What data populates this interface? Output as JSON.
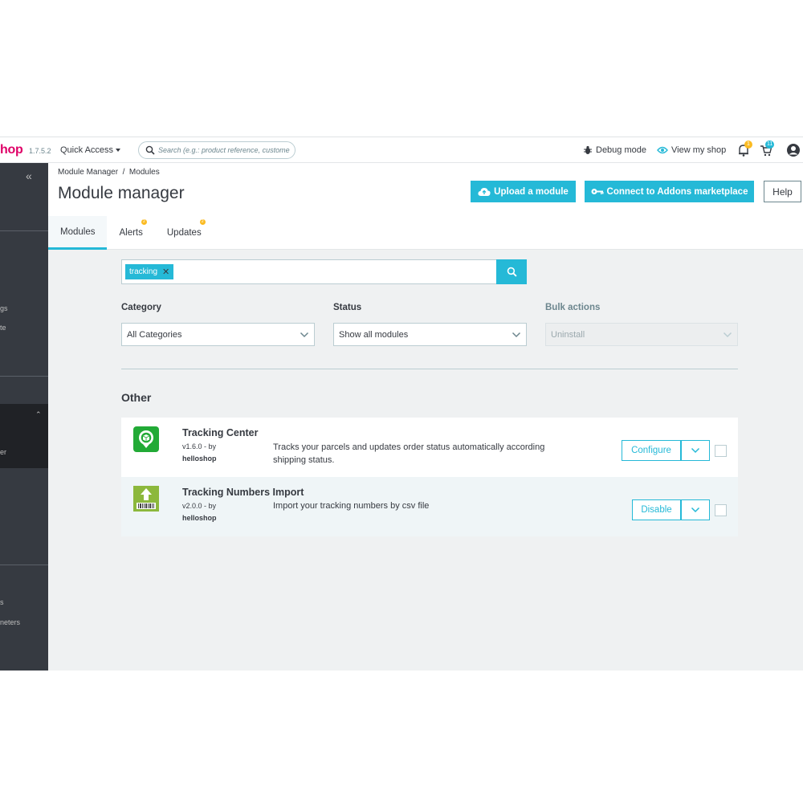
{
  "header": {
    "logo_text": "hop",
    "version": "1.7.5.2",
    "quick_access": "Quick Access",
    "search_placeholder": "Search (e.g.: product reference, custome",
    "debug_mode": "Debug mode",
    "view_shop": "View my shop",
    "notifications_count": "1",
    "orders_count": "11"
  },
  "sidebar": {
    "collapse_glyph": "«",
    "fragments": [
      "gs",
      "te",
      "er",
      "s",
      "neters"
    ]
  },
  "page": {
    "breadcrumb": "Module Manager  /  Modules",
    "title": "Module manager",
    "upload_button": "Upload a module",
    "addons_button": "Connect to Addons marketplace",
    "help_button": "Help",
    "tabs": [
      {
        "label": "Modules",
        "badge": ""
      },
      {
        "label": "Alerts",
        "badge": "2"
      },
      {
        "label": "Updates",
        "badge": "2"
      }
    ]
  },
  "filters": {
    "search_tag": "tracking",
    "category_label": "Category",
    "category_value": "All Categories",
    "status_label": "Status",
    "status_value": "Show all modules",
    "bulk_label": "Bulk actions",
    "bulk_value": "Uninstall"
  },
  "section": {
    "title": "Other"
  },
  "modules": [
    {
      "name": "Tracking Center",
      "version": "v1.6.0 - by",
      "author": "helloshop",
      "description": "Tracks your parcels and updates order status automatically according shipping status.",
      "action": "Configure"
    },
    {
      "name": "Tracking Numbers Import",
      "version": "v2.0.0 - by",
      "author": "helloshop",
      "description": "Import your tracking numbers by csv file",
      "action": "Disable"
    }
  ],
  "colors": {
    "accent": "#25b9d7",
    "brand": "#df0067",
    "sidebar": "#363a41",
    "badge": "#fbbb22"
  },
  "icons": [
    "search-icon",
    "bug-icon",
    "eye-icon",
    "bell-icon",
    "cart-icon",
    "user-icon",
    "cloud-upload-icon",
    "key-icon",
    "chevron-down-icon",
    "close-icon"
  ]
}
